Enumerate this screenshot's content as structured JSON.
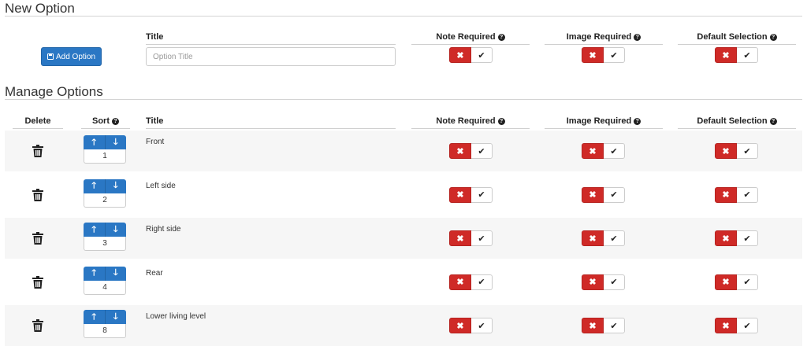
{
  "new_option": {
    "heading": "New Option",
    "add_button_label": "Add Option",
    "title_header": "Title",
    "title_placeholder": "Option Title",
    "note_required_header": "Note Required",
    "image_required_header": "Image Required",
    "default_selection_header": "Default Selection"
  },
  "manage_options": {
    "heading": "Manage Options",
    "headers": {
      "delete": "Delete",
      "sort": "Sort",
      "title": "Title",
      "note_required": "Note Required",
      "image_required": "Image Required",
      "default_selection": "Default Selection"
    },
    "rows": [
      {
        "title": "Front",
        "sort": "1"
      },
      {
        "title": "Left side",
        "sort": "2"
      },
      {
        "title": "Right side",
        "sort": "3"
      },
      {
        "title": "Rear",
        "sort": "4"
      },
      {
        "title": "Lower living level",
        "sort": "8"
      }
    ]
  },
  "toggle": {
    "no_glyph": "✖",
    "yes_glyph": "✔"
  },
  "sort_arrows": {
    "up": "🡑",
    "down": "🡓"
  },
  "help_glyph": "?",
  "colors": {
    "primary": "#2a77c4",
    "danger": "#cf2a27",
    "stripe": "#f6f6f6"
  }
}
